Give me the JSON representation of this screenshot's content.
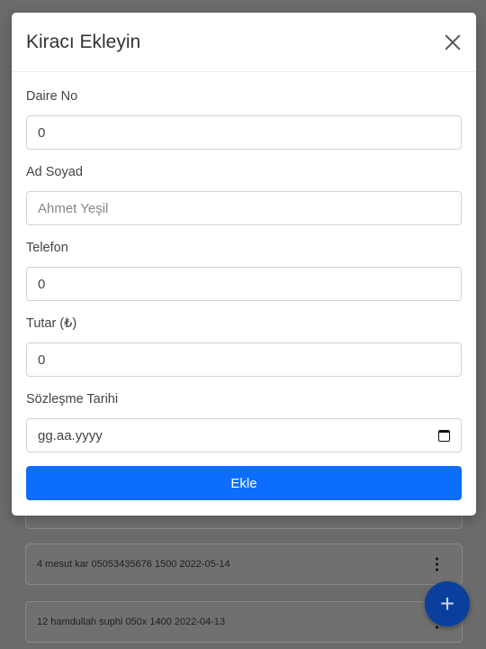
{
  "modal": {
    "title": "Kiracı Ekleyin",
    "fields": [
      {
        "label": "Daire No",
        "value": "0",
        "placeholder": ""
      },
      {
        "label": "Ad Soyad",
        "value": "",
        "placeholder": "Ahmet Yeşil"
      },
      {
        "label": "Telefon",
        "value": "0",
        "placeholder": ""
      },
      {
        "label": "Tutar (₺)",
        "value": "0",
        "placeholder": ""
      },
      {
        "label": "Sözleşme Tarihi",
        "value": "gg.aa.yyyy",
        "placeholder": ""
      }
    ],
    "submit_label": "Ekle"
  },
  "background_list": [
    {
      "text": ""
    },
    {
      "text": "4 mesut kar 05053435676 1500 2022-05-14"
    },
    {
      "text": "12 hamdullah suphi 050x 1400 2022-04-13"
    }
  ],
  "fab": {
    "label": "+"
  },
  "icons": {
    "close": "close-icon",
    "calendar": "calendar-icon",
    "kebab": "kebab-menu-icon",
    "fab": "plus-icon"
  },
  "colors": {
    "primary": "#0d6efd",
    "fab": "#0a3f9e",
    "overlay": "#6b6b6b"
  }
}
